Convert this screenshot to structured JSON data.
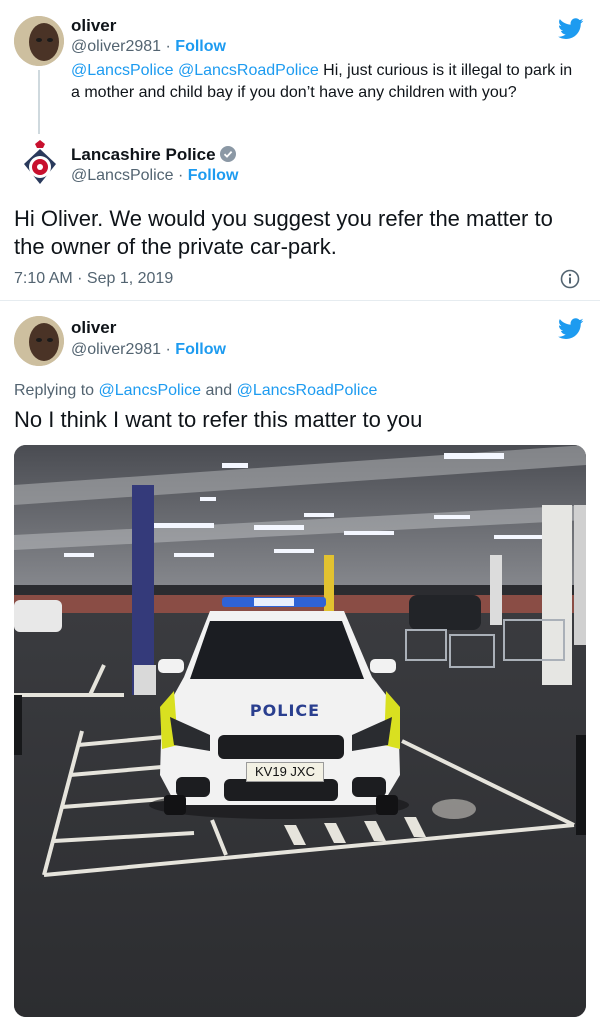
{
  "tweet1": {
    "name": "oliver",
    "handle": "@oliver2981",
    "separator": " · ",
    "follow": "Follow",
    "mention1": "@LancsPolice",
    "mention2": "@LancsRoadPolice",
    "text": " Hi, just curious is it illegal to park in a mother and child bay if you don’t have any children with you?"
  },
  "tweet2": {
    "name": "Lancashire Police",
    "handle": "@LancsPolice",
    "separator": " · ",
    "follow": "Follow",
    "text": "Hi Oliver. We would you suggest you refer the matter to the owner of the private car-park.",
    "timestamp": "7:10 AM · Sep 1, 2019"
  },
  "tweet3": {
    "name": "oliver",
    "handle": "@oliver2981",
    "separator": " · ",
    "follow": "Follow",
    "replying_prefix": "Replying to ",
    "replying_mention1": "@LancsPolice",
    "replying_and": " and ",
    "replying_mention2": "@LancsRoadPolice",
    "text": "No I think I want to refer this matter to you"
  },
  "photo": {
    "car_label": "POLICE",
    "plate": "KV19 JXC"
  },
  "colors": {
    "twitter_blue": "#1d9bf0",
    "text_dark": "#0f1419",
    "text_gray": "#536471"
  }
}
